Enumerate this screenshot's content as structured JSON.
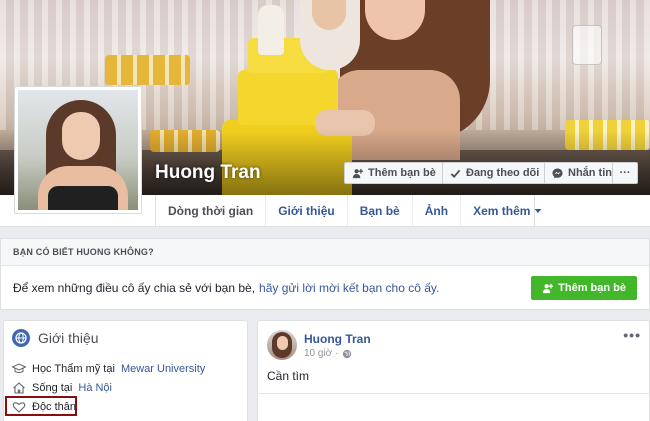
{
  "profile": {
    "name": "Huong Tran"
  },
  "cover_actions": {
    "add_friend": "Thêm bạn bè",
    "following": "Đang theo dõi",
    "message": "Nhắn tin",
    "more": "···"
  },
  "nav": {
    "tabs": [
      {
        "label": "Dòng thời gian"
      },
      {
        "label": "Giới thiệu"
      },
      {
        "label": "Bạn bè"
      },
      {
        "label": "Ảnh"
      },
      {
        "label": "Xem thêm"
      }
    ]
  },
  "know_card": {
    "heading": "BẠN CÓ BIẾT HUONG KHÔNG?",
    "text": "Để xem những điều cô ấy chia sẻ với bạn bè,",
    "link": "hãy gửi lời mời kết bạn cho cô ấy.",
    "button": "Thêm bạn bè"
  },
  "intro": {
    "title": "Giới thiệu",
    "education_prefix": "Học Thẩm mỹ tại",
    "education_link": "Mewar University",
    "lives_prefix": "Sống tại",
    "lives_link": "Hà Nội",
    "relationship": "Độc thân"
  },
  "post": {
    "author": "Huong Tran",
    "time": "10 giờ",
    "text": "Cần tìm",
    "more": "•••"
  },
  "colors": {
    "link_blue": "#365899",
    "facebook_blue": "#4267b2",
    "green": "#42b72a",
    "highlight_red": "#8b0e0e"
  }
}
